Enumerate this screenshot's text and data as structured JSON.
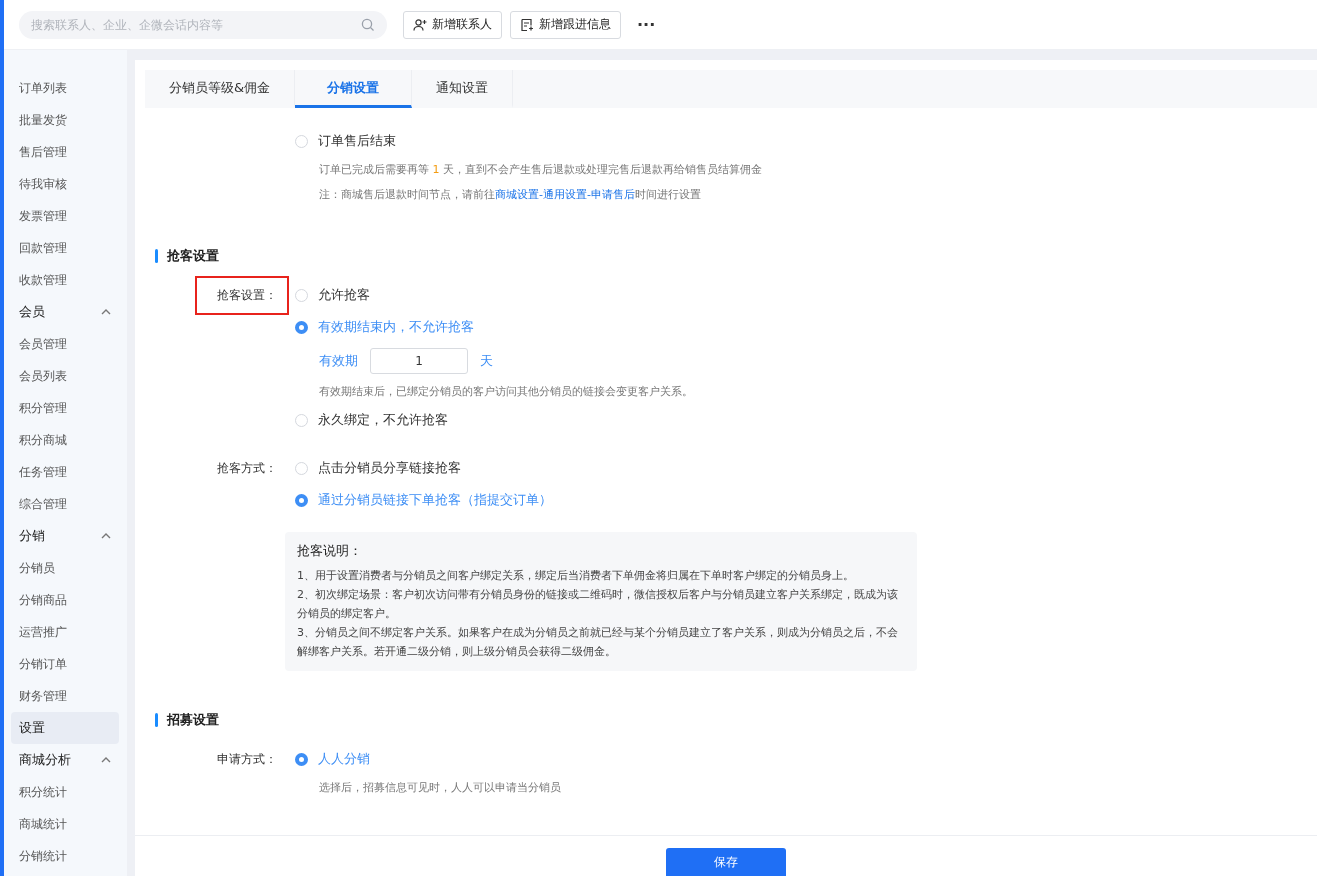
{
  "topbar": {
    "search": {
      "placeholder": "搜索联系人、企业、企微会话内容等"
    },
    "buttons": [
      {
        "kind": "contact",
        "label": "新增联系人"
      },
      {
        "kind": "followup",
        "label": "新增跟进信息"
      }
    ],
    "more": "···"
  },
  "sidebar": {
    "items": [
      {
        "kind": "item",
        "label": "订单列表",
        "selected": false
      },
      {
        "kind": "item",
        "label": "批量发货",
        "selected": false
      },
      {
        "kind": "item",
        "label": "售后管理",
        "selected": false
      },
      {
        "kind": "item",
        "label": "待我审核",
        "selected": false
      },
      {
        "kind": "item",
        "label": "发票管理",
        "selected": false
      },
      {
        "kind": "item",
        "label": "回款管理",
        "selected": false
      },
      {
        "kind": "item",
        "label": "收款管理",
        "selected": false
      },
      {
        "kind": "group",
        "label": "会员",
        "expanded": true,
        "children": [
          {
            "label": "会员管理",
            "selected": false
          },
          {
            "label": "会员列表",
            "selected": false
          },
          {
            "label": "积分管理",
            "selected": false
          },
          {
            "label": "积分商城",
            "selected": false
          },
          {
            "label": "任务管理",
            "selected": false
          },
          {
            "label": "综合管理",
            "selected": false
          }
        ]
      },
      {
        "kind": "group",
        "label": "分销",
        "expanded": true,
        "children": [
          {
            "label": "分销员",
            "selected": false
          },
          {
            "label": "分销商品",
            "selected": false
          },
          {
            "label": "运营推广",
            "selected": false
          },
          {
            "label": "分销订单",
            "selected": false
          },
          {
            "label": "财务管理",
            "selected": false
          },
          {
            "label": "设置",
            "selected": true
          }
        ]
      },
      {
        "kind": "group",
        "label": "商城分析",
        "expanded": true,
        "children": [
          {
            "label": "积分统计",
            "selected": false
          },
          {
            "label": "商城统计",
            "selected": false
          },
          {
            "label": "分销统计",
            "selected": false
          }
        ]
      }
    ]
  },
  "tabs": [
    {
      "label": "分销员等级&佣金",
      "selected": false
    },
    {
      "label": "分销设置",
      "selected": true
    },
    {
      "label": "通知设置",
      "selected": false
    }
  ],
  "settlement": {
    "option": {
      "label": "订单售后结束",
      "selected": false
    },
    "desc_before": "订单已完成后需要再等",
    "desc_value": "1",
    "desc_after": "天，直到不会产生售后退款或处理完售后退款再给销售员结算佣金",
    "note_before": "注：商城售后退款时间节点，请前往",
    "note_link": "商城设置-通用设置-申请售后",
    "note_after": "时间进行设置"
  },
  "grab_section": {
    "title": "抢客设置",
    "rows": [
      {
        "label": "抢客设置：",
        "highlighted": true,
        "options": [
          {
            "label": "允许抢客",
            "selected": false
          },
          {
            "label": "有效期结束内，不允许抢客",
            "selected": true,
            "validity": {
              "label": "有效期",
              "value": "1",
              "unit": "天"
            },
            "hint": "有效期结束后，已绑定分销员的客户访问其他分销员的链接会变更客户关系。"
          },
          {
            "label": "永久绑定，不允许抢客",
            "selected": false
          }
        ]
      },
      {
        "label": "抢客方式：",
        "highlighted": false,
        "options": [
          {
            "label": "点击分销员分享链接抢客",
            "selected": false
          },
          {
            "label": "通过分销员链接下单抢客（指提交订单）",
            "selected": true
          }
        ]
      }
    ],
    "info": {
      "title": "抢客说明：",
      "lines": [
        "1、用于设置消费者与分销员之间客户绑定关系，绑定后当消费者下单佣金将归属在下单时客户绑定的分销员身上。",
        "2、初次绑定场景：客户初次访问带有分销员身份的链接或二维码时，微信授权后客户与分销员建立客户关系绑定，既成为该分销员的绑定客户。",
        "3、分销员之间不绑定客户关系。如果客户在成为分销员之前就已经与某个分销员建立了客户关系，则成为分销员之后，不会解绑客户关系。若开通二级分销，则上级分销员会获得二级佣金。"
      ]
    }
  },
  "recruit_section": {
    "title": "招募设置",
    "rows": [
      {
        "label": "申请方式：",
        "highlighted": false,
        "options": [
          {
            "label": "人人分销",
            "selected": true,
            "hint": "选择后，招募信息可见时，人人可以申请当分销员"
          }
        ]
      }
    ]
  },
  "save_button": "保存"
}
